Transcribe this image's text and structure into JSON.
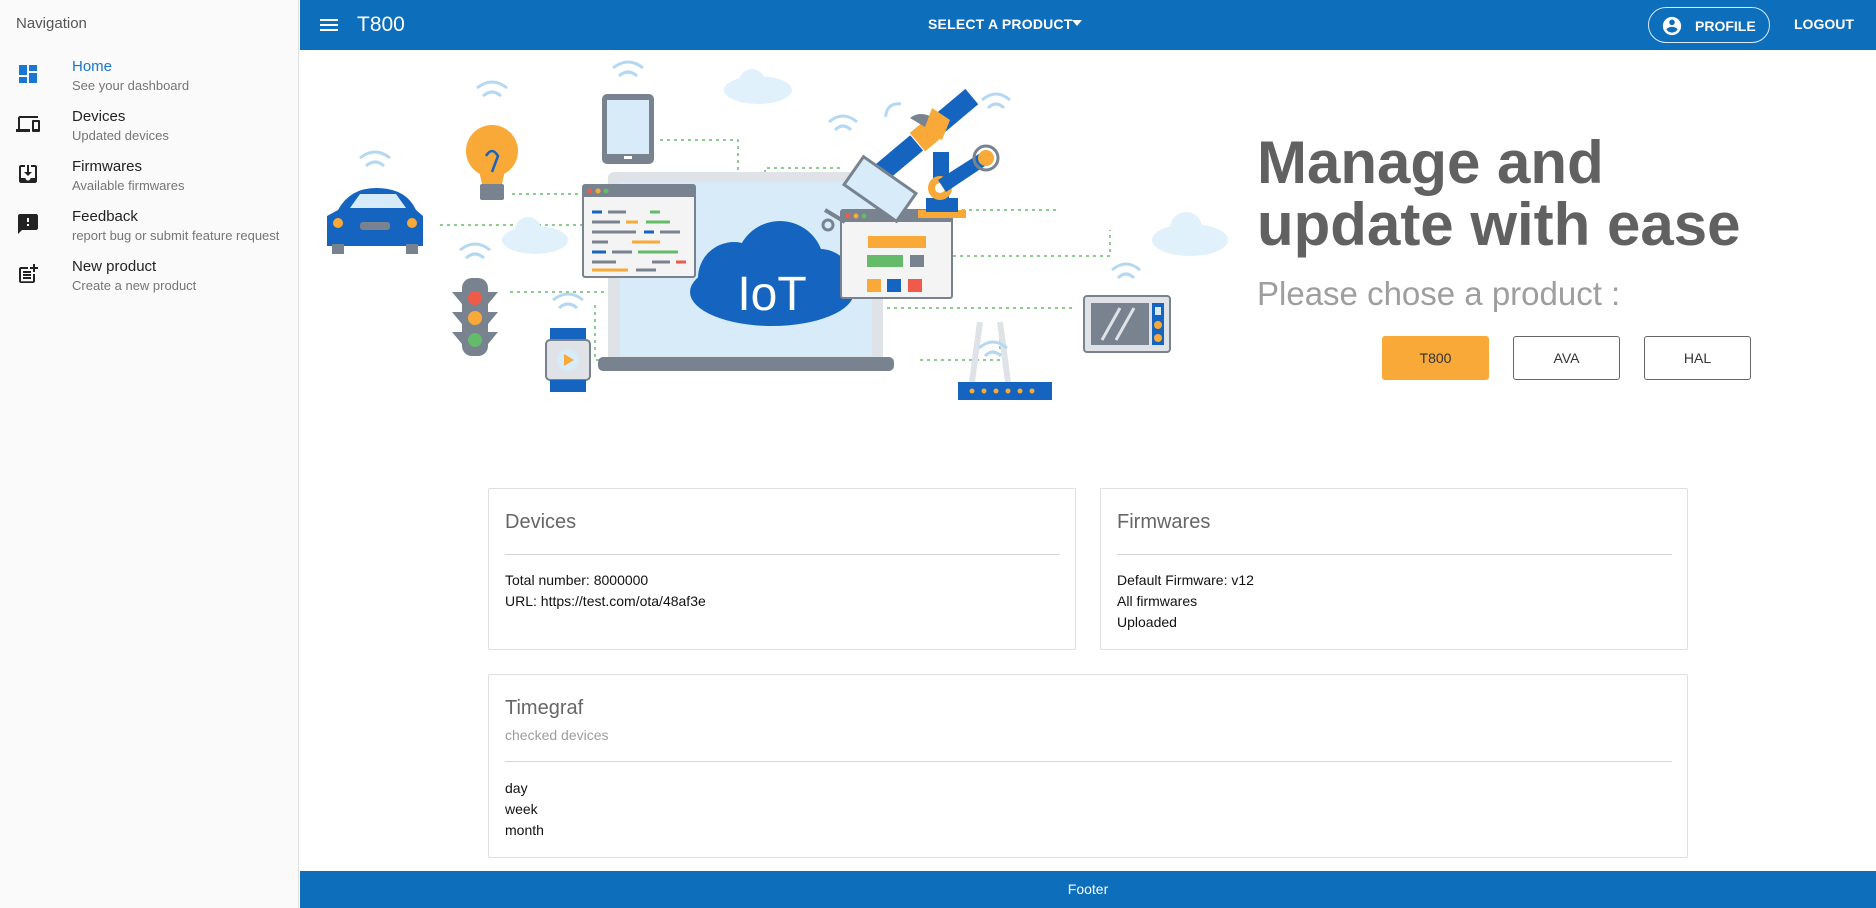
{
  "sidebar": {
    "title": "Navigation",
    "items": [
      {
        "label": "Home",
        "sub": "See your dashboard"
      },
      {
        "label": "Devices",
        "sub": "Updated devices"
      },
      {
        "label": "Firmwares",
        "sub": "Available firmwares"
      },
      {
        "label": "Feedback",
        "sub": "report bug or submit feature request"
      },
      {
        "label": "New product",
        "sub": "Create a new product"
      }
    ]
  },
  "header": {
    "title": "T800",
    "select_label": "SELECT A PRODUCT",
    "profile_label": "PROFILE",
    "logout_label": "LOGOUT",
    "color": "#0d6ebc"
  },
  "hero": {
    "headline": "Manage and update with ease",
    "subheadline": "Please chose a product :",
    "illustration_text": "IoT",
    "products": [
      {
        "label": "T800",
        "selected": true
      },
      {
        "label": "AVA",
        "selected": false
      },
      {
        "label": "HAL",
        "selected": false
      }
    ],
    "accent_color": "#f9a937"
  },
  "cards": {
    "devices": {
      "title": "Devices",
      "lines": [
        "Total number: 8000000",
        "URL: https://test.com/ota/48af3e"
      ]
    },
    "firmwares": {
      "title": "Firmwares",
      "lines": [
        "Default Firmware: v12",
        "All firmwares",
        "Uploaded"
      ]
    },
    "timegraf": {
      "title": "Timegraf",
      "subtitle": "checked devices",
      "lines": [
        "day",
        "week",
        "month"
      ]
    }
  },
  "footer": {
    "text": "Footer"
  }
}
